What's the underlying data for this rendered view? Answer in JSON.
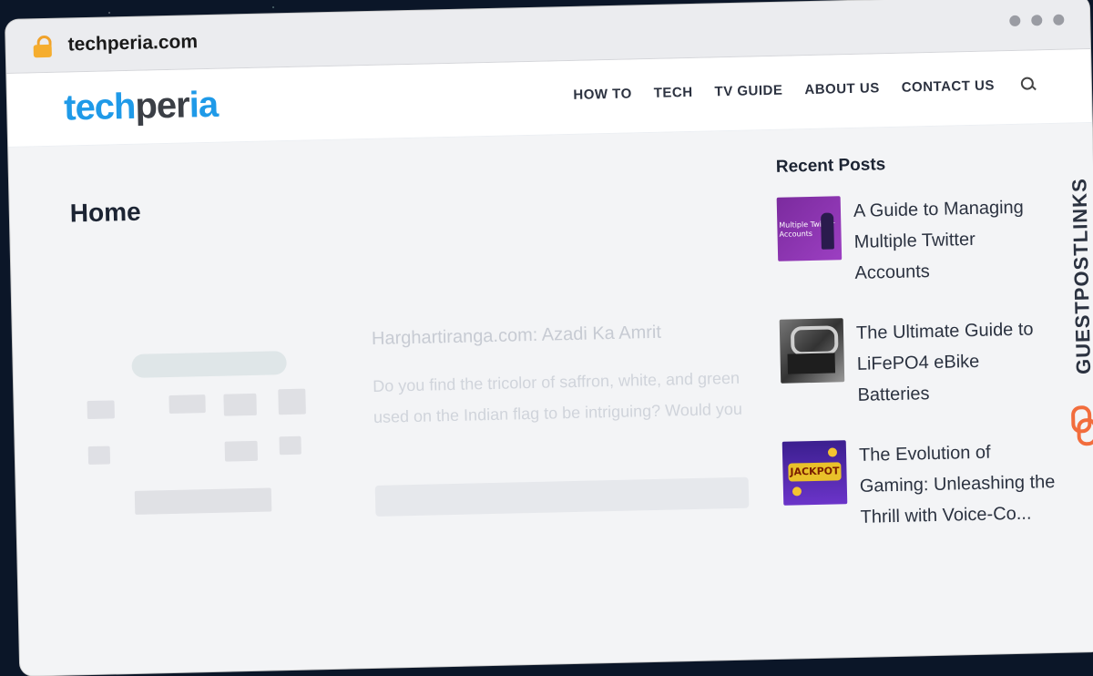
{
  "browser": {
    "url": "techperia.com"
  },
  "site": {
    "logo": {
      "part1": "tech",
      "part2": "per",
      "part3": "ia"
    },
    "nav": [
      "HOW TO",
      "TECH",
      "TV GUIDE",
      "ABOUT US",
      "CONTACT US"
    ]
  },
  "page": {
    "title": "Home"
  },
  "ghost": {
    "title": "Harghartiranga.com: Azadi Ka Amrit",
    "text": "Do you find the tricolor of saffron, white, and green used on the Indian flag to be intriguing? Would you"
  },
  "sidebar": {
    "title": "Recent Posts",
    "posts": [
      {
        "title": "A Guide to Managing Multiple Twitter Accounts",
        "thumb_text": "Multiple Twitter Accounts"
      },
      {
        "title": "The Ultimate Guide to LiFePO4 eBike Batteries"
      },
      {
        "title": "The Evolution of Gaming: Unleashing the Thrill with Voice-Co...",
        "thumb_text": "JACKPOT"
      }
    ]
  },
  "badge": {
    "text": "GUESTPOSTLINKS"
  }
}
